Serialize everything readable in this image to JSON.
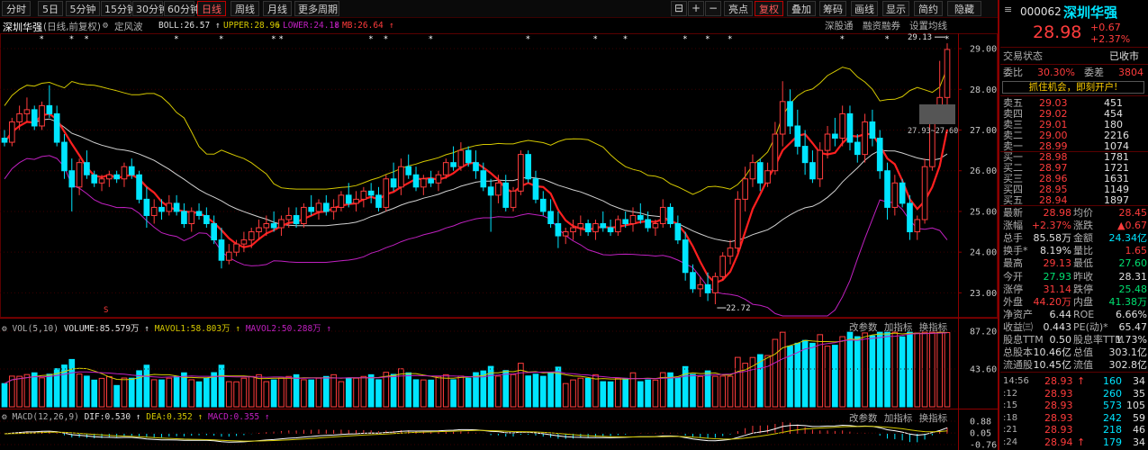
{
  "toolbar": {
    "periods": [
      "分时",
      "5日",
      "5分钟",
      "15分钟",
      "30分钟",
      "60分钟",
      "日线",
      "周线",
      "月线",
      "更多周期"
    ],
    "active_period": "日线",
    "right_buttons": [
      "亮点",
      "复权",
      "叠加",
      "筹码",
      "画线",
      "显示",
      "简约"
    ],
    "right_active": "复权",
    "last_button": "隐藏"
  },
  "strip": {
    "stock_name": "深圳华强",
    "mode": "(日线,前复权)",
    "fixed": "定风波",
    "boll": "BOLL:26.57",
    "upper": "UPPER:28.96",
    "lower": "LOWER:24.18",
    "mid": "MB:26.64",
    "links": [
      "深股通",
      "融资融券",
      "设置均线"
    ]
  },
  "colors": {
    "up": "#ff3c3c",
    "down": "#00e5ff",
    "ma": "#ff1f1f",
    "upper": "#d4c800",
    "lower": "#c020c0",
    "mid": "#d0d0d0",
    "flat": "#ffffff"
  },
  "price_axis": [
    "29.00",
    "28.00",
    "27.00",
    "26.00",
    "25.00",
    "24.00",
    "23.00"
  ],
  "annotations": {
    "high": "29.13",
    "low": "22.72",
    "range": "27.93~27.60",
    "marker": "S"
  },
  "volume_panel": {
    "title": "VOL(5,10)",
    "volume": "VOLUME:85.579万",
    "mavol1": "MAVOL1:58.803万",
    "mavol2": "MAVOL2:50.288万",
    "buttons": [
      "改参数",
      "加指标",
      "换指标"
    ],
    "axis": [
      "87.20",
      "43.60"
    ]
  },
  "macd_panel": {
    "title": "MACD(12,26,9)",
    "dif": "DIF:0.530",
    "dea": "DEA:0.352",
    "macd": "MACD:0.355",
    "buttons": [
      "改参数",
      "加指标",
      "换指标"
    ],
    "axis": [
      "0.88",
      "0.05",
      "-0.76"
    ]
  },
  "chart_data": {
    "type": "candlestick",
    "ylim": [
      22.5,
      29.2
    ],
    "candles": [
      [
        26.8,
        27.0,
        26.6,
        26.7
      ],
      [
        26.7,
        27.3,
        26.6,
        27.2
      ],
      [
        27.2,
        27.6,
        27.0,
        27.4
      ],
      [
        27.4,
        27.8,
        27.2,
        27.5
      ],
      [
        27.5,
        27.6,
        27.0,
        27.1
      ],
      [
        27.1,
        27.7,
        27.0,
        27.6
      ],
      [
        27.6,
        28.1,
        27.3,
        27.4
      ],
      [
        27.4,
        27.6,
        26.6,
        26.7
      ],
      [
        26.7,
        26.9,
        25.8,
        26.0
      ],
      [
        26.0,
        26.3,
        25.0,
        25.6
      ],
      [
        25.6,
        26.3,
        25.4,
        26.2
      ],
      [
        26.2,
        26.5,
        25.8,
        25.9
      ],
      [
        25.9,
        26.0,
        25.6,
        25.7
      ],
      [
        25.7,
        25.9,
        25.5,
        25.8
      ],
      [
        25.8,
        26.0,
        25.6,
        25.9
      ],
      [
        25.9,
        26.0,
        25.7,
        25.8
      ],
      [
        25.8,
        26.2,
        25.6,
        26.1
      ],
      [
        26.1,
        26.3,
        25.8,
        25.9
      ],
      [
        25.9,
        26.0,
        25.2,
        25.3
      ],
      [
        25.3,
        25.6,
        24.6,
        24.9
      ],
      [
        24.9,
        25.3,
        24.7,
        25.1
      ],
      [
        25.1,
        25.3,
        24.8,
        25.0
      ],
      [
        25.0,
        25.4,
        24.9,
        25.2
      ],
      [
        25.2,
        25.4,
        24.9,
        25.0
      ],
      [
        25.0,
        25.2,
        24.6,
        24.7
      ],
      [
        24.7,
        25.1,
        24.5,
        25.0
      ],
      [
        25.0,
        25.2,
        24.8,
        24.9
      ],
      [
        24.9,
        25.1,
        24.6,
        24.7
      ],
      [
        24.7,
        24.9,
        24.2,
        24.3
      ],
      [
        24.3,
        24.6,
        23.6,
        23.8
      ],
      [
        23.8,
        24.2,
        23.7,
        24.0
      ],
      [
        24.0,
        24.3,
        23.9,
        24.2
      ],
      [
        24.2,
        24.5,
        24.0,
        24.3
      ],
      [
        24.3,
        24.6,
        24.1,
        24.5
      ],
      [
        24.5,
        24.8,
        24.3,
        24.6
      ],
      [
        24.6,
        24.9,
        24.4,
        24.7
      ],
      [
        24.7,
        25.0,
        24.5,
        24.6
      ],
      [
        24.6,
        24.9,
        24.4,
        24.8
      ],
      [
        24.8,
        25.1,
        24.6,
        24.9
      ],
      [
        24.9,
        25.1,
        24.6,
        24.7
      ],
      [
        24.7,
        25.2,
        24.6,
        25.1
      ],
      [
        25.1,
        25.4,
        24.9,
        25.0
      ],
      [
        25.0,
        25.3,
        24.8,
        25.2
      ],
      [
        25.2,
        25.4,
        24.9,
        25.0
      ],
      [
        25.0,
        25.3,
        24.8,
        25.1
      ],
      [
        25.1,
        25.5,
        25.0,
        25.4
      ],
      [
        25.4,
        25.7,
        25.1,
        25.2
      ],
      [
        25.2,
        25.5,
        25.0,
        25.3
      ],
      [
        25.3,
        25.6,
        25.1,
        25.5
      ],
      [
        25.5,
        25.7,
        25.2,
        25.4
      ],
      [
        25.4,
        25.6,
        25.0,
        25.1
      ],
      [
        25.1,
        25.9,
        25.0,
        25.8
      ],
      [
        25.8,
        26.2,
        25.5,
        25.6
      ],
      [
        25.6,
        26.3,
        25.4,
        26.1
      ],
      [
        26.1,
        26.4,
        25.8,
        25.9
      ],
      [
        25.9,
        26.1,
        25.5,
        25.6
      ],
      [
        25.6,
        25.9,
        25.4,
        25.8
      ],
      [
        25.8,
        26.0,
        25.6,
        25.7
      ],
      [
        25.7,
        26.0,
        25.5,
        25.9
      ],
      [
        25.9,
        26.3,
        25.8,
        26.2
      ],
      [
        26.2,
        26.6,
        26.0,
        26.1
      ],
      [
        26.1,
        26.7,
        26.0,
        26.5
      ],
      [
        26.5,
        26.6,
        26.1,
        26.2
      ],
      [
        26.2,
        26.5,
        25.8,
        26.0
      ],
      [
        26.0,
        26.2,
        25.5,
        25.6
      ],
      [
        25.6,
        25.8,
        24.5,
        25.4
      ],
      [
        25.4,
        25.9,
        25.2,
        25.7
      ],
      [
        25.7,
        25.9,
        25.0,
        25.1
      ],
      [
        25.1,
        25.6,
        25.0,
        25.5
      ],
      [
        25.5,
        26.5,
        25.4,
        26.4
      ],
      [
        26.4,
        26.5,
        25.7,
        25.8
      ],
      [
        25.8,
        26.0,
        25.2,
        25.3
      ],
      [
        25.3,
        25.5,
        24.9,
        25.0
      ],
      [
        25.0,
        25.3,
        24.6,
        24.7
      ],
      [
        24.7,
        25.0,
        24.1,
        24.4
      ],
      [
        24.4,
        24.6,
        24.2,
        24.5
      ],
      [
        24.5,
        24.8,
        24.3,
        24.6
      ],
      [
        24.6,
        24.9,
        24.4,
        24.7
      ],
      [
        24.7,
        24.8,
        24.4,
        24.5
      ],
      [
        24.5,
        24.8,
        24.3,
        24.7
      ],
      [
        24.7,
        25.0,
        24.5,
        24.6
      ],
      [
        24.6,
        24.8,
        24.4,
        24.5
      ],
      [
        24.5,
        24.9,
        24.4,
        24.8
      ],
      [
        24.8,
        25.0,
        24.6,
        24.7
      ],
      [
        24.7,
        25.1,
        24.5,
        24.9
      ],
      [
        24.9,
        25.2,
        24.7,
        24.8
      ],
      [
        24.8,
        25.0,
        24.5,
        24.6
      ],
      [
        24.6,
        24.8,
        24.4,
        24.7
      ],
      [
        24.7,
        25.3,
        24.6,
        25.1
      ],
      [
        25.1,
        25.2,
        24.6,
        24.7
      ],
      [
        24.7,
        24.9,
        24.2,
        24.3
      ],
      [
        24.3,
        24.5,
        23.3,
        23.5
      ],
      [
        23.5,
        23.7,
        23.0,
        23.1
      ],
      [
        23.1,
        23.4,
        22.9,
        23.2
      ],
      [
        23.2,
        23.5,
        22.8,
        23.0
      ],
      [
        23.0,
        23.5,
        22.72,
        23.4
      ],
      [
        23.4,
        24.0,
        23.3,
        23.9
      ],
      [
        23.9,
        24.3,
        23.7,
        24.1
      ],
      [
        24.1,
        25.5,
        24.0,
        25.3
      ],
      [
        25.3,
        26.1,
        25.0,
        25.8
      ],
      [
        25.8,
        26.4,
        25.6,
        26.2
      ],
      [
        26.2,
        26.3,
        25.5,
        25.7
      ],
      [
        25.7,
        26.2,
        25.6,
        26.0
      ],
      [
        26.0,
        27.2,
        25.9,
        26.9
      ],
      [
        26.9,
        28.2,
        26.6,
        27.7
      ],
      [
        27.7,
        28.0,
        26.9,
        27.1
      ],
      [
        27.1,
        27.5,
        26.4,
        26.6
      ],
      [
        26.6,
        27.0,
        25.9,
        26.2
      ],
      [
        26.2,
        26.5,
        25.7,
        25.8
      ],
      [
        25.8,
        26.7,
        25.6,
        26.5
      ],
      [
        26.5,
        27.1,
        26.3,
        26.9
      ],
      [
        26.9,
        27.3,
        26.6,
        26.8
      ],
      [
        26.8,
        27.6,
        26.6,
        27.4
      ],
      [
        27.4,
        27.6,
        26.5,
        26.7
      ],
      [
        26.7,
        26.9,
        26.2,
        26.4
      ],
      [
        26.4,
        27.4,
        26.2,
        27.2
      ],
      [
        27.2,
        27.5,
        26.6,
        26.8
      ],
      [
        26.8,
        27.0,
        25.8,
        26.0
      ],
      [
        26.0,
        26.2,
        24.8,
        25.1
      ],
      [
        25.1,
        25.9,
        24.9,
        25.7
      ],
      [
        25.7,
        25.8,
        25.1,
        25.2
      ],
      [
        25.2,
        25.4,
        24.3,
        24.5
      ],
      [
        24.5,
        24.9,
        24.3,
        24.8
      ],
      [
        24.8,
        26.3,
        24.7,
        26.1
      ],
      [
        26.1,
        27.5,
        26.0,
        27.4
      ],
      [
        27.4,
        28.7,
        27.3,
        27.8
      ],
      [
        27.8,
        29.13,
        27.6,
        28.98
      ]
    ]
  },
  "quote": {
    "code": "000062",
    "name": "深圳华强",
    "price": "28.98",
    "change": "+0.67",
    "pct": "+2.37%",
    "status_label": "交易状态",
    "status": "已收市",
    "weibi_label": "委比",
    "weibi": "30.30%",
    "weicha_label": "委差",
    "weicha": "3804",
    "banner": "抓住机会，即刻开户!",
    "sells": [
      {
        "label": "卖五",
        "price": "29.03",
        "vol": "451"
      },
      {
        "label": "卖四",
        "price": "29.02",
        "vol": "454"
      },
      {
        "label": "卖三",
        "price": "29.01",
        "vol": "180"
      },
      {
        "label": "卖二",
        "price": "29.00",
        "vol": "2216"
      },
      {
        "label": "卖一",
        "price": "28.99",
        "vol": "1074"
      }
    ],
    "buys": [
      {
        "label": "买一",
        "price": "28.98",
        "vol": "1781"
      },
      {
        "label": "买二",
        "price": "28.97",
        "vol": "1721"
      },
      {
        "label": "买三",
        "price": "28.96",
        "vol": "1631"
      },
      {
        "label": "买四",
        "price": "28.95",
        "vol": "1149"
      },
      {
        "label": "买五",
        "price": "28.94",
        "vol": "1897"
      }
    ],
    "stats": [
      {
        "l1": "最新",
        "v1": "28.98",
        "c1": "#ff3c3c",
        "l2": "均价",
        "v2": "28.45",
        "c2": "#ff3c3c"
      },
      {
        "l1": "涨幅",
        "v1": "+2.37%",
        "c1": "#ff3c3c",
        "l2": "涨跌",
        "v2": "▲0.67",
        "c2": "#ff3c3c"
      },
      {
        "l1": "总手",
        "v1": "85.58万",
        "c1": "#e0e0e0",
        "l2": "金额",
        "v2": "24.34亿",
        "c2": "#00e5ff"
      },
      {
        "l1": "换手*",
        "v1": "8.19%",
        "c1": "#e0e0e0",
        "l2": "量比",
        "v2": "1.65",
        "c2": "#ff3c3c"
      },
      {
        "l1": "最高",
        "v1": "29.13",
        "c1": "#ff3c3c",
        "l2": "最低",
        "v2": "27.60",
        "c2": "#00e070"
      },
      {
        "l1": "今开",
        "v1": "27.93",
        "c1": "#00e070",
        "l2": "昨收",
        "v2": "28.31",
        "c2": "#e0e0e0"
      },
      {
        "l1": "涨停",
        "v1": "31.14",
        "c1": "#ff3c3c",
        "l2": "跌停",
        "v2": "25.48",
        "c2": "#00e070"
      },
      {
        "l1": "外盘",
        "v1": "44.20万",
        "c1": "#ff3c3c",
        "l2": "内盘",
        "v2": "41.38万",
        "c2": "#00e070"
      },
      {
        "l1": "净资产",
        "v1": "6.44",
        "c1": "#e0e0e0",
        "l2": "ROE",
        "v2": "6.66%",
        "c2": "#e0e0e0"
      },
      {
        "l1": "收益㈢",
        "v1": "0.443",
        "c1": "#e0e0e0",
        "l2": "PE(动)*",
        "v2": "65.47",
        "c2": "#e0e0e0"
      },
      {
        "l1": "股息TTM",
        "v1": "0.50",
        "c1": "#e0e0e0",
        "l2": "股息率TTM",
        "v2": "1.73%",
        "c2": "#e0e0e0"
      },
      {
        "l1": "总股本",
        "v1": "10.46亿",
        "c1": "#e0e0e0",
        "l2": "总值",
        "v2": "303.1亿",
        "c2": "#e0e0e0"
      },
      {
        "l1": "流通股",
        "v1": "10.45亿",
        "c1": "#e0e0e0",
        "l2": "流值",
        "v2": "302.8亿",
        "c2": "#e0e0e0"
      }
    ],
    "ticks": [
      {
        "time": "14:56",
        "price": "28.93",
        "arrow": "↑",
        "vol": "160",
        "num": "34"
      },
      {
        "time": ":12",
        "price": "28.93",
        "arrow": "",
        "vol": "260",
        "num": "35"
      },
      {
        "time": ":15",
        "price": "28.93",
        "arrow": "",
        "vol": "573",
        "num": "105"
      },
      {
        "time": ":18",
        "price": "28.93",
        "arrow": "",
        "vol": "242",
        "num": "59"
      },
      {
        "time": ":21",
        "price": "28.93",
        "arrow": "",
        "vol": "218",
        "num": "46"
      },
      {
        "time": ":24",
        "price": "28.94",
        "arrow": "↑",
        "vol": "179",
        "num": "34"
      }
    ]
  }
}
